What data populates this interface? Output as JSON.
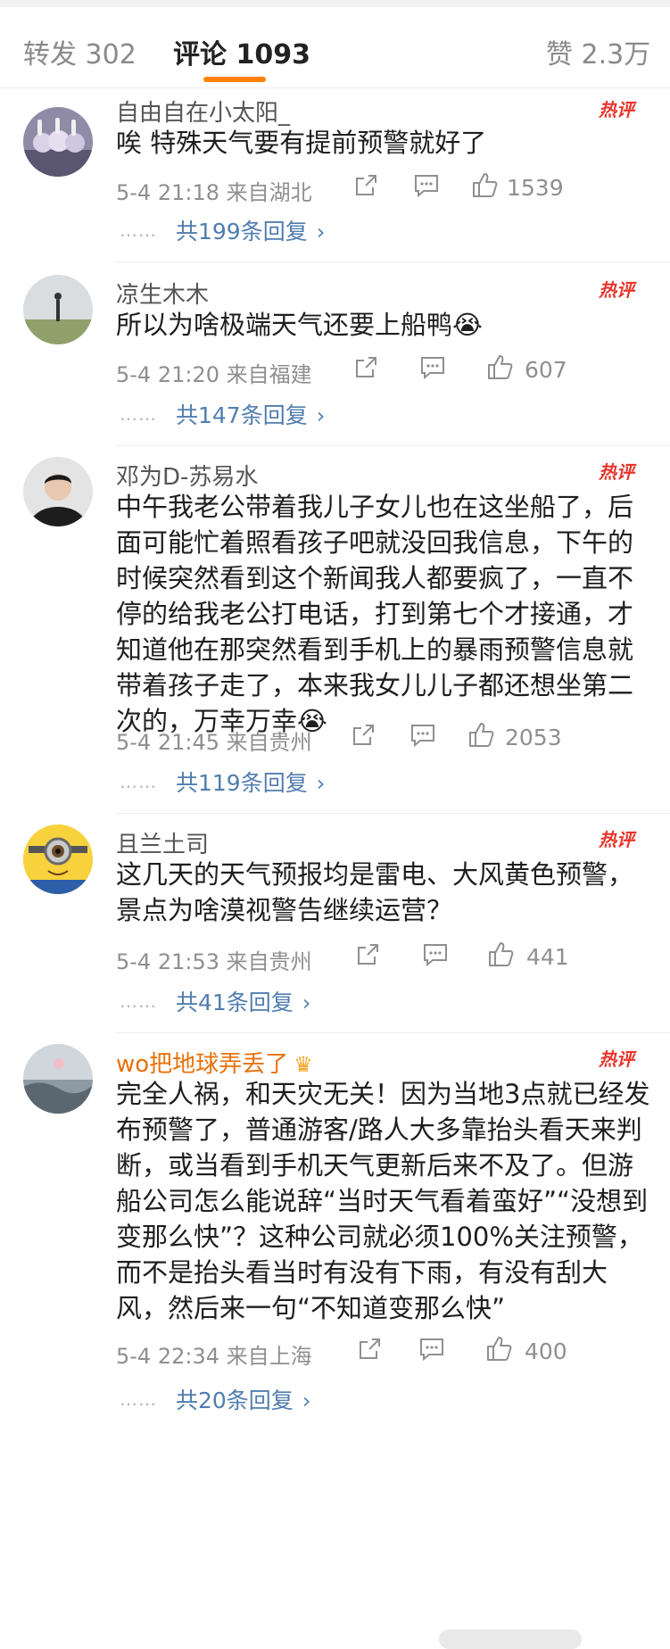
{
  "tabs": {
    "repost": "转发 302",
    "comments": "评论 1093",
    "likes": "赞 2.3万"
  },
  "hot_label": "热评",
  "comments": [
    {
      "username": "自由自在小太阳_",
      "text": "唉 特殊天气要有提前预警就好了",
      "time": "5-4 21:18",
      "location": "来自湖北",
      "likes": "1539",
      "replies": "共199条回复"
    },
    {
      "username": "凉生木木",
      "text": "所以为啥极端天气还要上船鸭😭",
      "time": "5-4 21:20",
      "location": "来自福建",
      "likes": "607",
      "replies": "共147条回复"
    },
    {
      "username": "邓为D-苏易水",
      "text": "中午我老公带着我儿子女儿也在这坐船了，后面可能忙着照看孩子吧就没回我信息，下午的时候突然看到这个新闻我人都要疯了，一直不停的给我老公打电话，打到第七个才接通，才知道他在那突然看到手机上的暴雨预警信息就带着孩子走了，本来我女儿儿子都还想坐第二次的，万幸万幸😭",
      "time": "5-4 21:45",
      "location": "来自贵州",
      "likes": "2053",
      "replies": "共119条回复"
    },
    {
      "username": "且兰土司",
      "text": "这几天的天气预报均是雷电、大风黄色预警，景点为啥漠视警告继续运营？",
      "time": "5-4 21:53",
      "location": "来自贵州",
      "likes": "441",
      "replies": "共41条回复"
    },
    {
      "username": "wo把地球弄丢了",
      "text": "完全人祸，和天灾无关！因为当地3点就已经发布预警了，普通游客/路人大多靠抬头看天来判断，或当看到手机天气更新后来不及了。但游船公司怎么能说辞“当时天气看着蛮好”“没想到变那么快”？这种公司就必须100%关注预警，而不是抬头看当时有没有下雨，有没有刮大风，然后来一句“不知道变那么快”",
      "time": "5-4 22:34",
      "location": "来自上海",
      "likes": "400",
      "replies": "共20条回复"
    }
  ],
  "colors": {
    "accent": "#ff8200",
    "link": "#507daf",
    "hot": "#e8352c",
    "vip_name": "#e8710a"
  }
}
